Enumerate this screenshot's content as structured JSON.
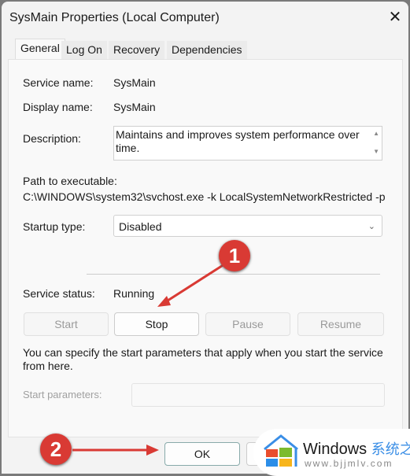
{
  "window": {
    "title": "SysMain Properties (Local Computer)",
    "close_icon": "close-icon"
  },
  "tabs": [
    {
      "label": "General",
      "active": true
    },
    {
      "label": "Log On"
    },
    {
      "label": "Recovery"
    },
    {
      "label": "Dependencies"
    }
  ],
  "general": {
    "service_name_label": "Service name:",
    "service_name": "SysMain",
    "display_name_label": "Display name:",
    "display_name": "SysMain",
    "description_label": "Description:",
    "description": "Maintains and improves system performance over time.",
    "path_label": "Path to executable:",
    "path": "C:\\WINDOWS\\system32\\svchost.exe -k LocalSystemNetworkRestricted -p",
    "startup_type_label": "Startup type:",
    "startup_type": "Disabled",
    "service_status_label": "Service status:",
    "service_status": "Running",
    "buttons": {
      "start": "Start",
      "stop": "Stop",
      "pause": "Pause",
      "resume": "Resume"
    },
    "hint": "You can specify the start parameters that apply when you start the service from here.",
    "start_params_label": "Start parameters:",
    "start_params_value": ""
  },
  "footer": {
    "ok": "OK"
  },
  "annotations": {
    "step1": "1",
    "step2": "2",
    "color": "#d93a34"
  },
  "watermark": {
    "brand": "Windows",
    "suffix": "系统之家",
    "url": "www.bjjmlv.com"
  }
}
